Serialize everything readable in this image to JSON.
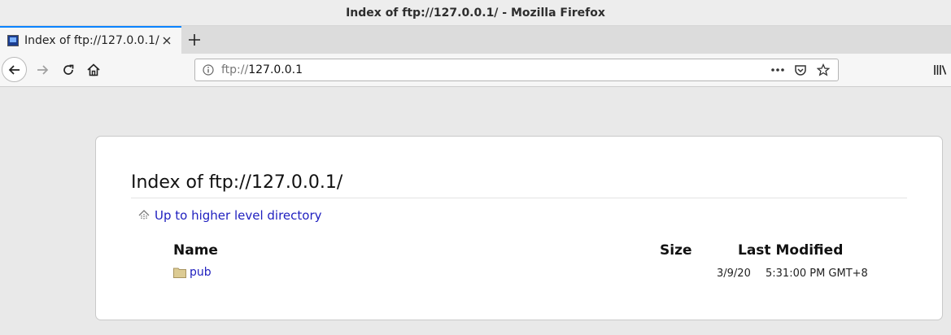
{
  "window": {
    "title": "Index of ftp://127.0.0.1/ - Mozilla Firefox"
  },
  "tab": {
    "title": "Index of ftp://127.0.0.1/"
  },
  "urlbar": {
    "scheme": "ftp://",
    "host": "127.0.0.1"
  },
  "page": {
    "heading": "Index of ftp://127.0.0.1/",
    "up_link": "Up to higher level directory",
    "columns": {
      "name": "Name",
      "size": "Size",
      "modified": "Last Modified"
    },
    "rows": [
      {
        "name": "pub",
        "size": "",
        "date": "3/9/20",
        "time": "5:31:00 PM GMT+8",
        "type": "folder"
      }
    ]
  },
  "icons": {
    "tab_favicon": "computer-icon",
    "tab_close": "close-icon",
    "new_tab": "plus-icon",
    "back": "arrow-left-icon",
    "forward": "arrow-right-icon",
    "reload": "reload-icon",
    "home": "home-icon",
    "info": "info-icon",
    "page_actions": "more-icon",
    "pocket": "pocket-icon",
    "bookmark": "star-icon",
    "library": "library-icon",
    "up": "up-arrow-icon",
    "folder": "folder-icon"
  },
  "colors": {
    "link": "#1f1fbf",
    "tab_accent": "#0a84ff",
    "folder": "#d9c48a"
  }
}
